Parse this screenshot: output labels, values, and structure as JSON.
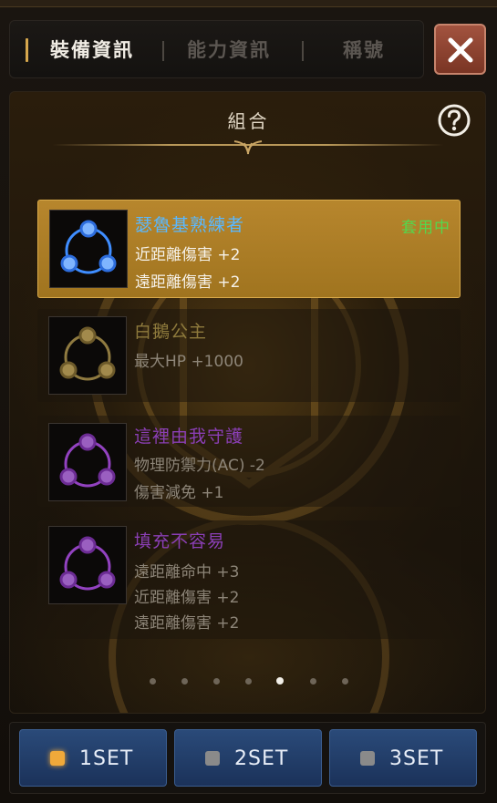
{
  "tabs": {
    "items": [
      {
        "label": "裝備資訊",
        "active": true
      },
      {
        "label": "能力資訊",
        "active": false
      },
      {
        "label": "稱號",
        "active": false
      }
    ]
  },
  "panel": {
    "title": "組合",
    "help_icon": "help-icon",
    "close_icon": "close-icon"
  },
  "sets": [
    {
      "name": "瑟魯基熟練者",
      "name_color": "#5ab8ff",
      "status": "套用中",
      "icon_color": "#3f8dff",
      "stats": [
        "近距離傷害 +2",
        "遠距離傷害 +2"
      ],
      "active": true
    },
    {
      "name": "白鵝公主",
      "name_color": "#8e7a3c",
      "status": "",
      "icon_color": "#8f7a40",
      "stats": [
        "最大HP +1000"
      ],
      "active": false
    },
    {
      "name": "這裡由我守護",
      "name_color": "#8b3fb6",
      "status": "",
      "icon_color": "#9242c0",
      "stats": [
        "物理防禦力(AC) -2",
        "傷害減免 +1"
      ],
      "active": false
    },
    {
      "name": "填充不容易",
      "name_color": "#8b3fb6",
      "status": "",
      "icon_color": "#9242c0",
      "stats": [
        "遠距離命中 +3",
        "近距離傷害 +2",
        "遠距離傷害 +2"
      ],
      "active": false
    }
  ],
  "pager": {
    "count": 7,
    "current": 5
  },
  "set_buttons": [
    {
      "label": "1SET",
      "active": true,
      "indicator_color": "#f0a93a"
    },
    {
      "label": "2SET",
      "active": false,
      "indicator_color": "#8a8a8a"
    },
    {
      "label": "3SET",
      "active": false,
      "indicator_color": "#8a8a8a"
    }
  ]
}
